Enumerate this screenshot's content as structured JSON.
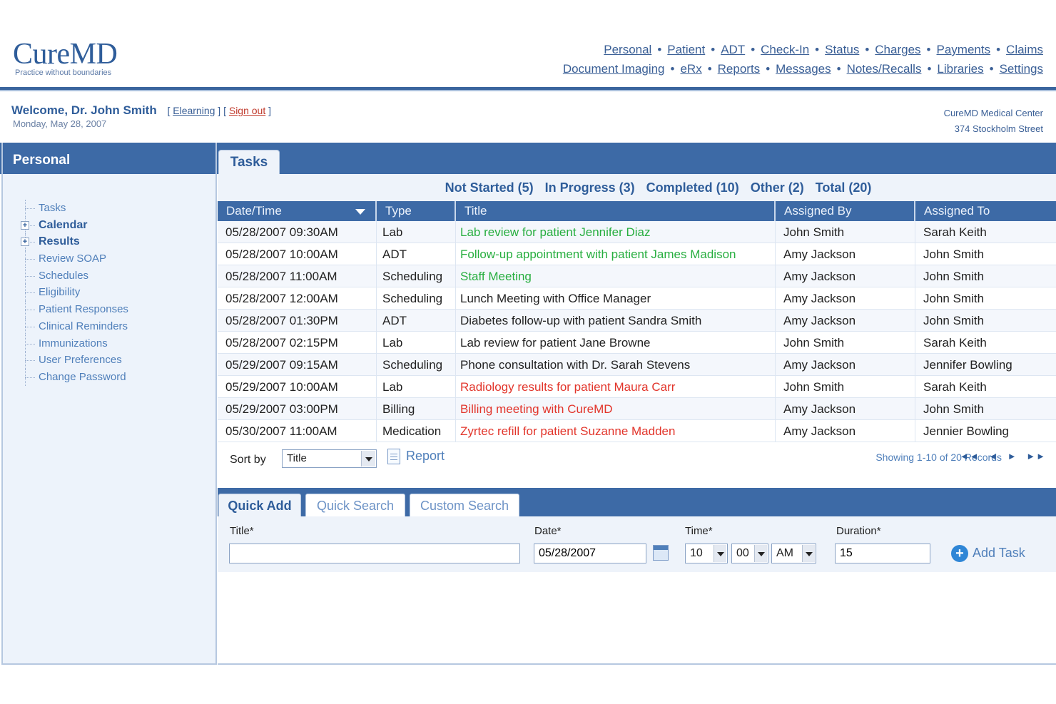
{
  "app": {
    "logo_name": "CureMD",
    "logo_tagline": "Practice without boundaries",
    "nav_row1": [
      "Personal",
      "Patient",
      "ADT",
      "Check-In",
      "Status",
      "Charges",
      "Payments",
      "Claims"
    ],
    "nav_row2": [
      "Document Imaging",
      "eRx",
      "Reports",
      "Messages",
      "Notes/Recalls",
      "Libraries",
      "Settings"
    ],
    "nav_separator": "•"
  },
  "welcome": {
    "text": "Welcome, Dr. John Smith",
    "open_bracket": "[",
    "elearning": "Elearning",
    "mid_bracket": "] [",
    "signout": "Sign out",
    "close_bracket": "]",
    "date": "Monday, May 28, 2007",
    "org_name": "CureMD Medical Center",
    "org_address": "374 Stockholm Street"
  },
  "sidebar": {
    "title": "Personal",
    "items": [
      {
        "label": "Tasks",
        "bold": false,
        "expandable": false
      },
      {
        "label": "Calendar",
        "bold": true,
        "expandable": true
      },
      {
        "label": "Results",
        "bold": true,
        "expandable": true
      },
      {
        "label": "Review SOAP",
        "bold": false,
        "expandable": false
      },
      {
        "label": "Schedules",
        "bold": false,
        "expandable": false
      },
      {
        "label": "Eligibility",
        "bold": false,
        "expandable": false
      },
      {
        "label": "Patient Responses",
        "bold": false,
        "expandable": false
      },
      {
        "label": "Clinical Reminders",
        "bold": false,
        "expandable": false
      },
      {
        "label": "Immunizations",
        "bold": false,
        "expandable": false
      },
      {
        "label": "User Preferences",
        "bold": false,
        "expandable": false
      },
      {
        "label": "Change Password",
        "bold": false,
        "expandable": false
      }
    ],
    "expand_glyph": "+"
  },
  "tasks": {
    "tab_label": "Tasks",
    "filters": [
      "Not Started (5)",
      "In Progress (3)",
      "Completed (10)",
      "Other (2)",
      "Total (20)"
    ],
    "columns": [
      "Date/Time",
      "Type",
      "Title",
      "Assigned By",
      "Assigned To"
    ],
    "rows": [
      {
        "datetime": "05/28/2007 09:30AM",
        "type": "Lab",
        "title": "Lab review for patient Jennifer Diaz",
        "assigned_by": "John Smith",
        "assigned_to": "Sarah Keith",
        "status": "green"
      },
      {
        "datetime": "05/28/2007 10:00AM",
        "type": "ADT",
        "title": "Follow-up appointment with patient James Madison",
        "assigned_by": "Amy Jackson",
        "assigned_to": "John Smith",
        "status": "green"
      },
      {
        "datetime": "05/28/2007 11:00AM",
        "type": "Scheduling",
        "title": "Staff Meeting",
        "assigned_by": "Amy Jackson",
        "assigned_to": "John Smith",
        "status": "green"
      },
      {
        "datetime": "05/28/2007 12:00AM",
        "type": "Scheduling",
        "title": "Lunch Meeting with Office Manager",
        "assigned_by": "Amy Jackson",
        "assigned_to": "John Smith",
        "status": "default"
      },
      {
        "datetime": "05/28/2007 01:30PM",
        "type": "ADT",
        "title": "Diabetes follow-up with patient Sandra Smith",
        "assigned_by": "Amy Jackson",
        "assigned_to": "John Smith",
        "status": "default"
      },
      {
        "datetime": "05/28/2007 02:15PM",
        "type": "Lab",
        "title": "Lab review for patient Jane Browne",
        "assigned_by": "John Smith",
        "assigned_to": "Sarah Keith",
        "status": "default"
      },
      {
        "datetime": "05/29/2007 09:15AM",
        "type": "Scheduling",
        "title": "Phone consultation with Dr. Sarah Stevens",
        "assigned_by": "Amy Jackson",
        "assigned_to": "Jennifer Bowling",
        "status": "default"
      },
      {
        "datetime": "05/29/2007 10:00AM",
        "type": "Lab",
        "title": "Radiology results for patient Maura Carr",
        "assigned_by": "John Smith",
        "assigned_to": "Sarah Keith",
        "status": "red"
      },
      {
        "datetime": "05/29/2007 03:00PM",
        "type": "Billing",
        "title": "Billing meeting with CureMD",
        "assigned_by": "Amy Jackson",
        "assigned_to": "John Smith",
        "status": "red"
      },
      {
        "datetime": "05/30/2007 11:00AM",
        "type": "Medication",
        "title": "Zyrtec refill for patient Suzanne Madden",
        "assigned_by": "Amy Jackson",
        "assigned_to": "Jennier Bowling",
        "status": "red"
      }
    ],
    "sort_label": "Sort by",
    "sort_value": "Title",
    "report_label": "Report",
    "showing": "Showing 1-10 of 20 Records",
    "pager": {
      "first": "◄◄",
      "prev": "◄",
      "next": "►",
      "last": "►►"
    }
  },
  "quick": {
    "tabs": [
      "Quick Add",
      "Quick Search",
      "Custom Search"
    ],
    "title_label": "Title*",
    "title_value": "",
    "date_label": "Date*",
    "date_value": "05/28/2007",
    "time_label": "Time*",
    "hour": "10",
    "minute": "00",
    "ampm": "AM",
    "duration_label": "Duration*",
    "duration_value": "15",
    "add_label": "Add Task",
    "add_glyph": "+"
  },
  "colors": {
    "brand_blue": "#3d6aa6",
    "link_blue": "#3a5f96",
    "green_status": "#27ae3f",
    "red_status": "#e2352b"
  }
}
